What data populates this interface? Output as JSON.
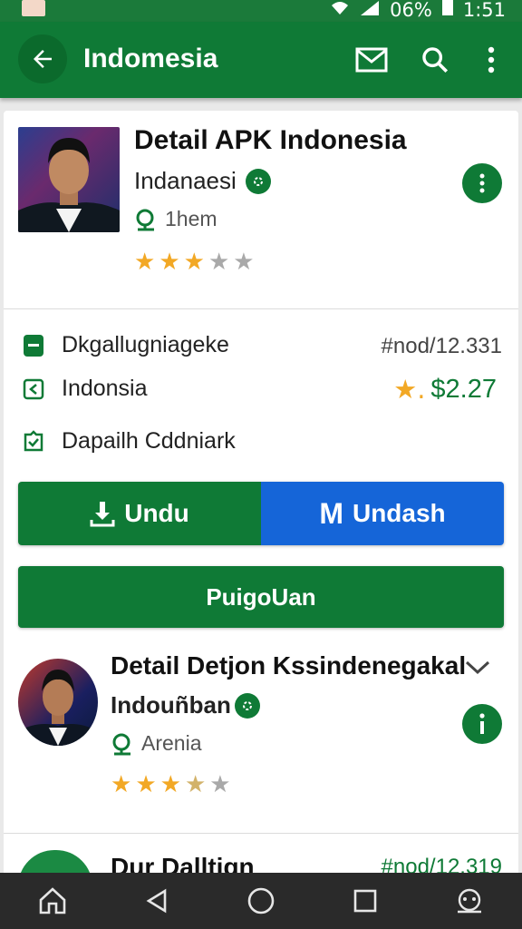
{
  "status_bar": {
    "battery_text": "06%",
    "time": "1:51"
  },
  "app_bar": {
    "title": "Indomesia"
  },
  "app1": {
    "title": "Detail APK Indonesia",
    "developer": "Indanaesi",
    "meta": "1hem",
    "rating": 3.5
  },
  "details": {
    "category": "Dkgallugniageke",
    "version": "#nod/12.331",
    "language": "Indonsia",
    "price": "$2.27",
    "link": "Dapailh Cddniark"
  },
  "buttons": {
    "download": "Undu",
    "share": "Undash",
    "share_glyph": "M",
    "main": "PuigoUan"
  },
  "app2": {
    "title": "Detail Detjon Kssindenegakal",
    "developer": "Indouñban",
    "meta": "Arenia",
    "rating": 3.5
  },
  "app3_peek": {
    "title": "Dur Dalltign",
    "version": "#nod/12.319"
  },
  "colors": {
    "primary_green": "#0f7a36",
    "accent_blue": "#1565d8",
    "star": "#f2a825"
  }
}
